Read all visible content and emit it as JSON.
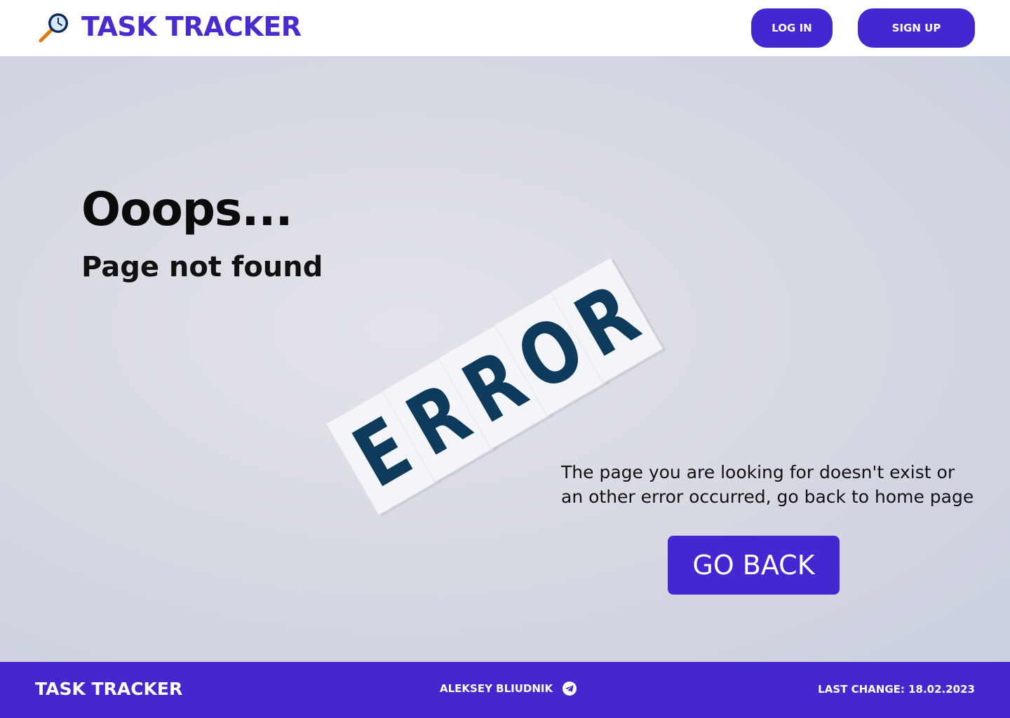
{
  "header": {
    "app_title": "TASK TRACKER",
    "logo_icon": "magnifier-clock-icon",
    "login_label": "LOG IN",
    "signup_label": "SIGN UP"
  },
  "main": {
    "heading": "Ooops...",
    "subheading": "Page not found",
    "message": "The page you are looking for doesn't exist or an other error occurred, go back to home page",
    "go_back_label": "GO BACK",
    "image": {
      "icon": "error-letter-tiles-image",
      "letters": [
        "E",
        "R",
        "R",
        "O",
        "R"
      ]
    }
  },
  "footer": {
    "title": "TASK TRACKER",
    "author": "ALEKSEY BLIUDNIK",
    "author_icon": "telegram-icon",
    "last_change": "LAST CHANGE: 18.02.2023"
  },
  "colors": {
    "brand": "#4a2bd0",
    "button": "#4527d1",
    "footer": "#4727cd",
    "tile_letter": "#0e3a5c",
    "background": "#d8dae3"
  }
}
